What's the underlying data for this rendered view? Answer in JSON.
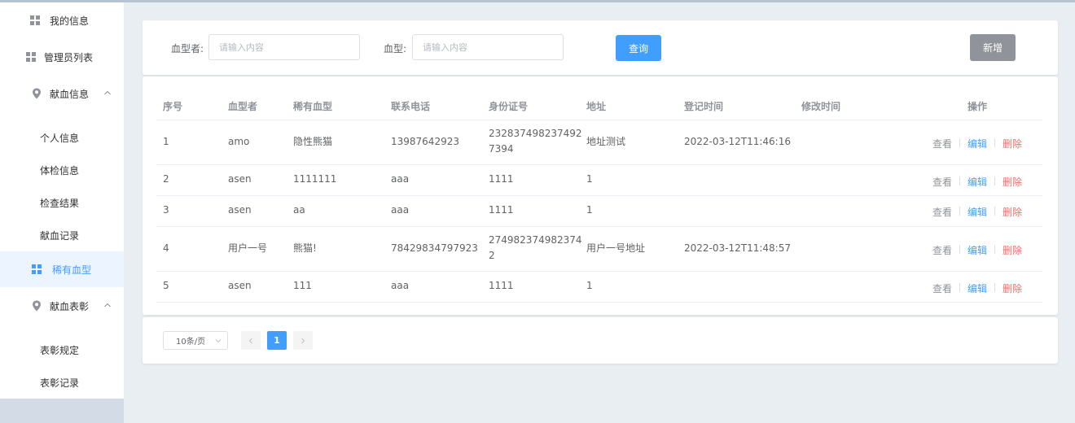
{
  "sidebar": {
    "items": [
      {
        "label": "我的信息",
        "icon": "grid-icon"
      },
      {
        "label": "管理员列表",
        "icon": "grid-icon"
      },
      {
        "label": "献血信息",
        "icon": "location-icon",
        "expanded": true
      },
      {
        "label": "个人信息"
      },
      {
        "label": "体检信息"
      },
      {
        "label": "检查结果"
      },
      {
        "label": "献血记录"
      },
      {
        "label": "稀有血型",
        "icon": "grid-icon",
        "active": true
      },
      {
        "label": "献血表彰",
        "icon": "location-icon",
        "expanded": true
      },
      {
        "label": "表彰规定"
      },
      {
        "label": "表彰记录"
      }
    ]
  },
  "search": {
    "donor_label": "血型者:",
    "donor_placeholder": "请输入内容",
    "bloodtype_label": "血型:",
    "bloodtype_placeholder": "请输入内容",
    "query_label": "查询",
    "add_label": "新增"
  },
  "table": {
    "headers": [
      "序号",
      "血型者",
      "稀有血型",
      "联系电话",
      "身份证号",
      "地址",
      "登记时间",
      "修改时间",
      "操作"
    ],
    "rows": [
      {
        "no": "1",
        "donor": "amo",
        "bloodtype": "隐性熊猫",
        "phone": "13987642923",
        "id_line1": "232837498237492",
        "id_line2": "7394",
        "address": "地址测试",
        "reg_time": "2022-03-12T11:46:16",
        "mod_time": ""
      },
      {
        "no": "2",
        "donor": "asen",
        "bloodtype": "1111111",
        "phone": "aaa",
        "id_line1": "1111",
        "id_line2": "",
        "address": "1",
        "reg_time": "",
        "mod_time": ""
      },
      {
        "no": "3",
        "donor": "asen",
        "bloodtype": "aa",
        "phone": "aaa",
        "id_line1": "1111",
        "id_line2": "",
        "address": "1",
        "reg_time": "",
        "mod_time": ""
      },
      {
        "no": "4",
        "donor": "用户一号",
        "bloodtype": "熊猫!",
        "phone": "78429834797923",
        "id_line1": "274982374982374",
        "id_line2": "2",
        "address": "用户一号地址",
        "reg_time": "2022-03-12T11:48:57",
        "mod_time": ""
      },
      {
        "no": "5",
        "donor": "asen",
        "bloodtype": "111",
        "phone": "aaa",
        "id_line1": "1111",
        "id_line2": "",
        "address": "1",
        "reg_time": "",
        "mod_time": ""
      }
    ],
    "actions": {
      "view": "查看",
      "edit": "编辑",
      "delete": "删除"
    }
  },
  "pager": {
    "page_size": "10条/页",
    "current_page": "1"
  },
  "colors": {
    "primary": "#409eff",
    "danger": "#f56c6c",
    "info": "#909399"
  }
}
